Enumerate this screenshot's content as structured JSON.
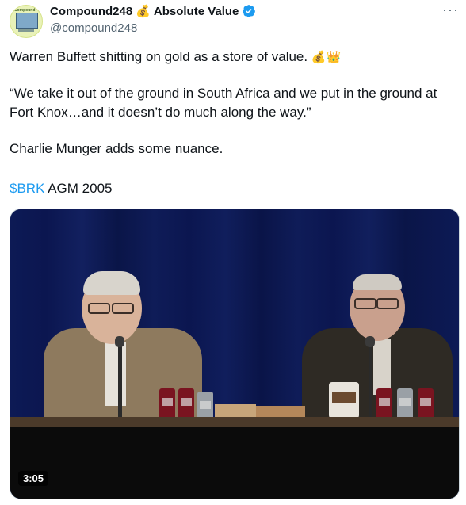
{
  "author": {
    "name": "Compound248",
    "name_emoji": "💰",
    "name_suffix": "Absolute Value",
    "handle": "@compound248",
    "verified": true,
    "accent": "#1d9bf0"
  },
  "more_label": "···",
  "tweet": {
    "line1": "Warren Buffett shitting on gold as a store of value.",
    "line1_emojis": "💰👑",
    "quote": "“We take it out of the ground in South Africa and we put in the ground at Fort Knox…and it doesn’t do much along the way.”",
    "line3": "Charlie Munger adds some nuance.",
    "cashtag": "$BRK",
    "line4_rest": " AGM 2005"
  },
  "video": {
    "duration": "3:05"
  }
}
